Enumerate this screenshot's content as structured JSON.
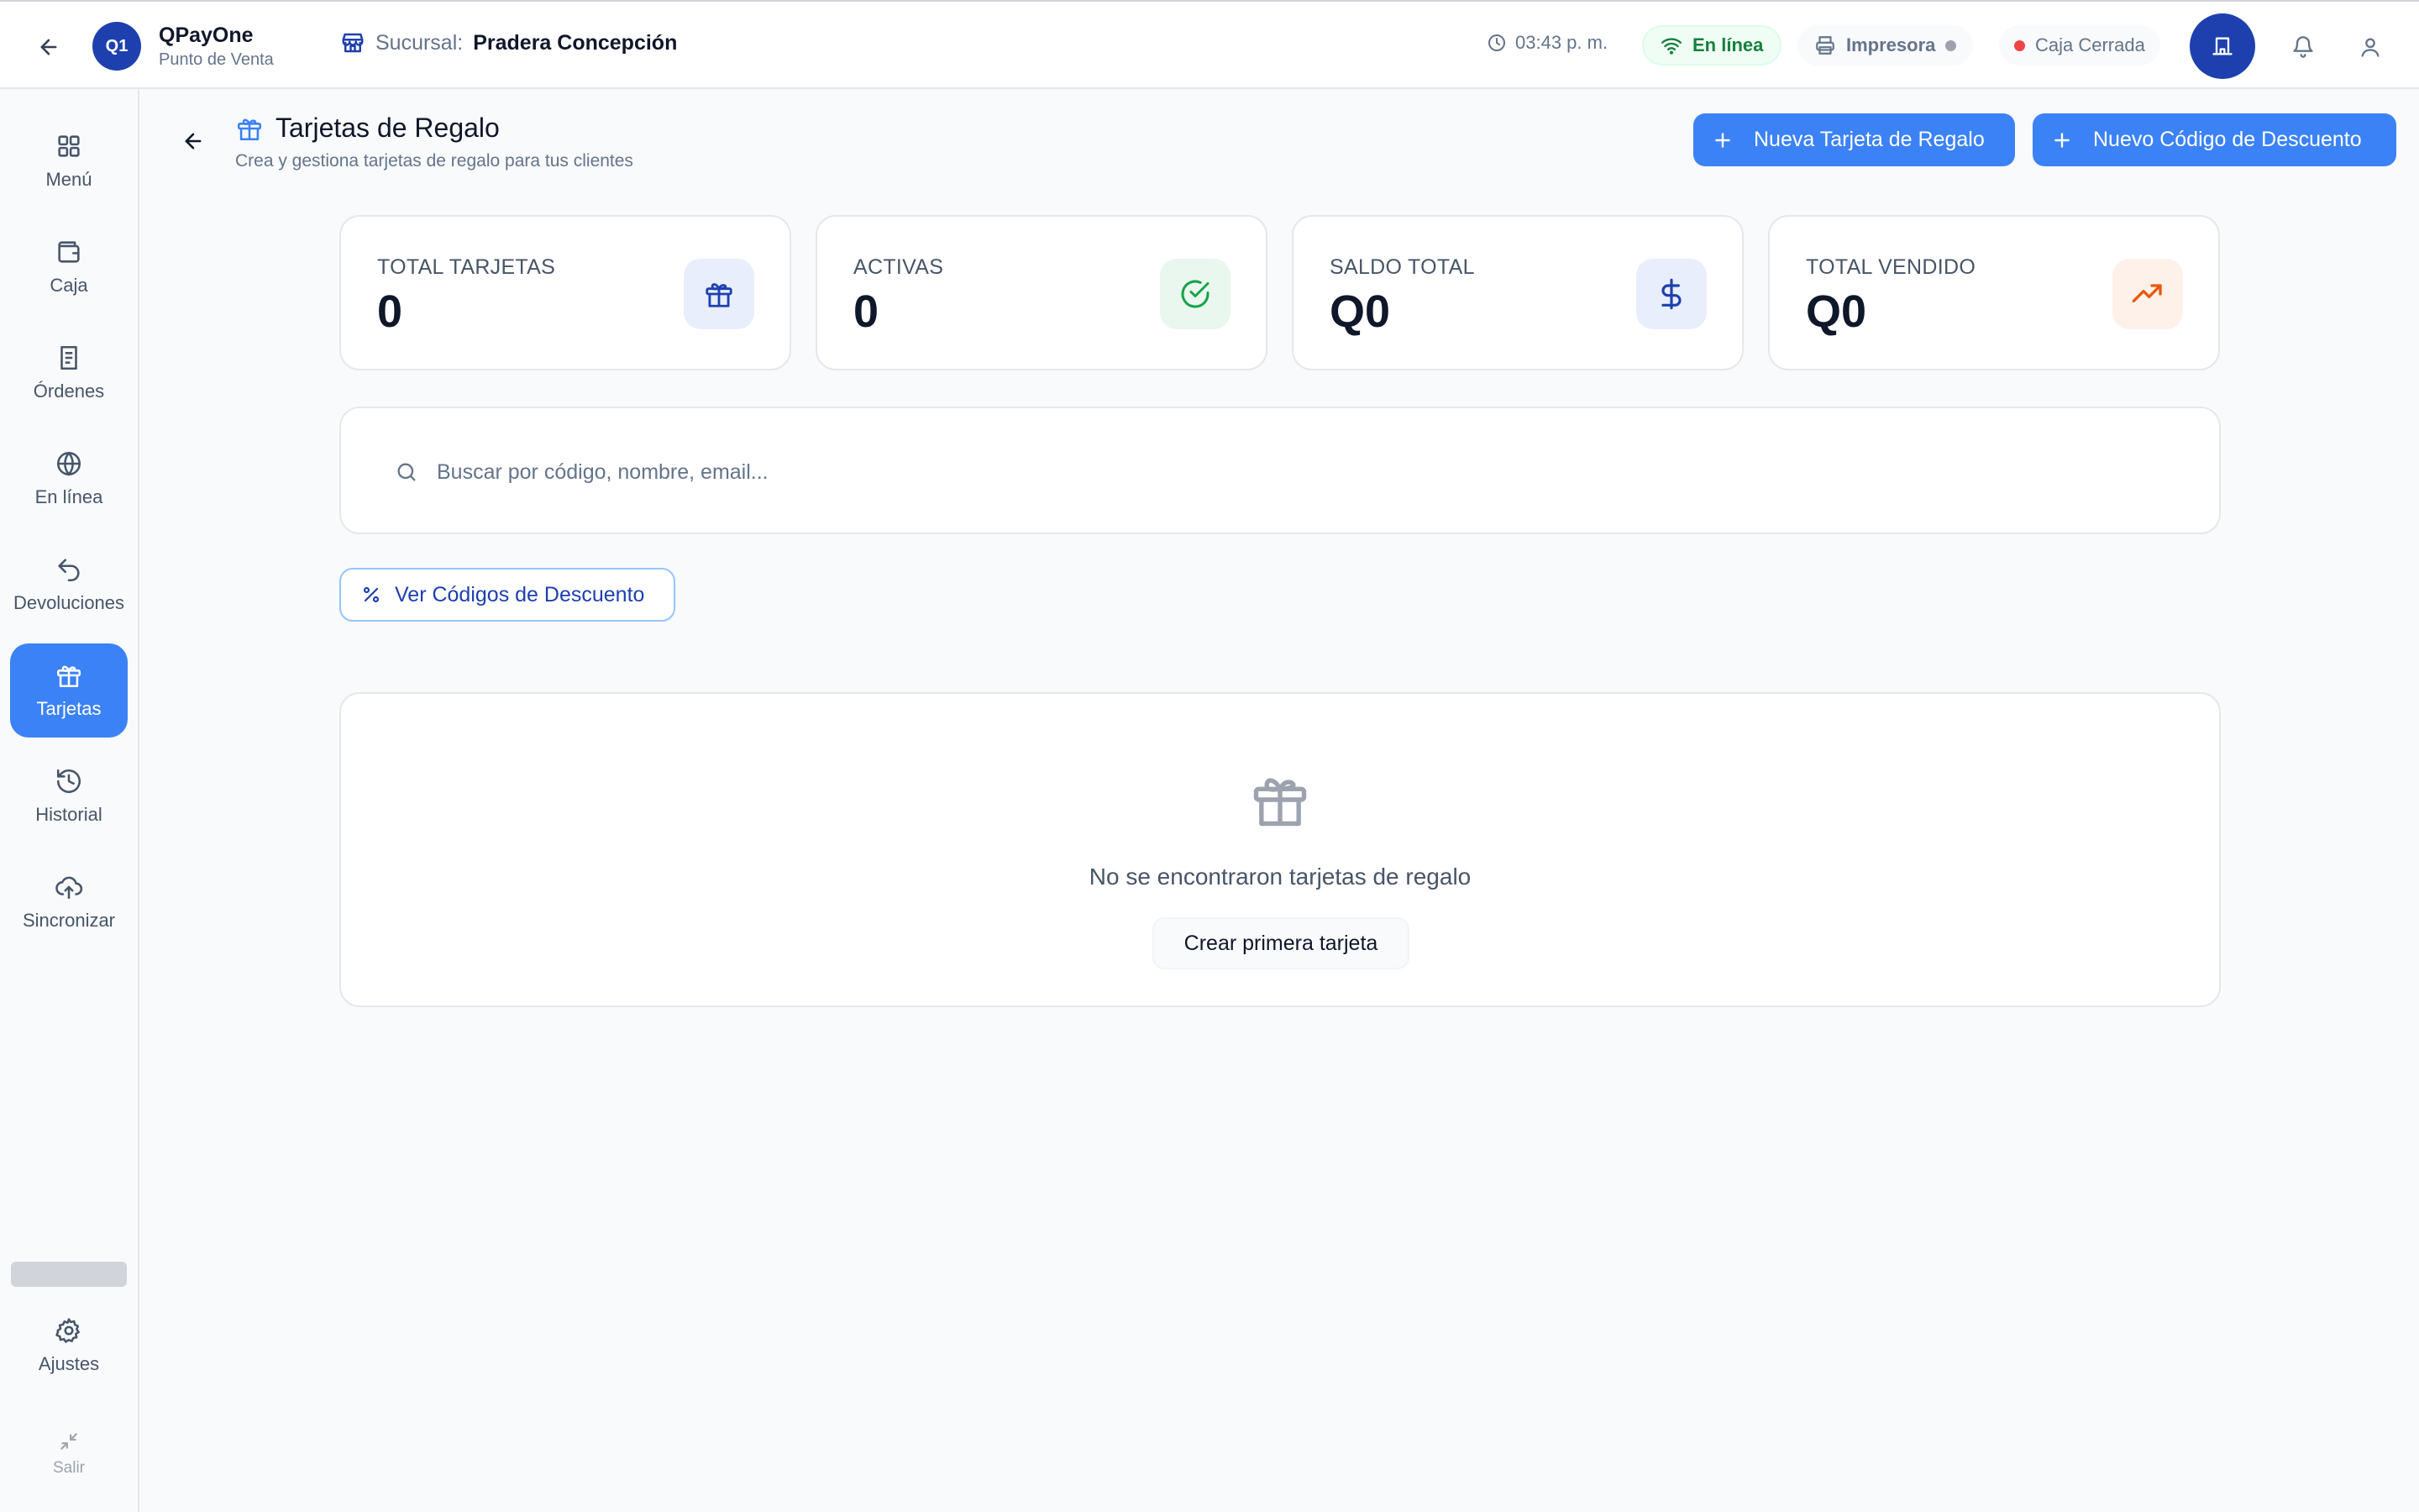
{
  "header": {
    "brand_initials": "Q1",
    "brand_title": "QPayOne",
    "brand_subtitle": "Punto de Venta",
    "branch_label": "Sucursal:",
    "branch_name": "Pradera Concepción",
    "time": "03:43 p. m.",
    "online_status": "En línea",
    "printer_label": "Impresora",
    "register_status": "Caja Cerrada"
  },
  "sidebar": {
    "items": [
      {
        "label": "Menú",
        "icon": "grid-icon"
      },
      {
        "label": "Caja",
        "icon": "wallet-icon"
      },
      {
        "label": "Órdenes",
        "icon": "receipt-icon"
      },
      {
        "label": "En línea",
        "icon": "globe-icon"
      },
      {
        "label": "Devoluciones",
        "icon": "undo-icon"
      },
      {
        "label": "Tarjetas",
        "icon": "gift-icon",
        "active": true
      },
      {
        "label": "Historial",
        "icon": "history-icon"
      },
      {
        "label": "Sincronizar",
        "icon": "cloud-upload-icon"
      }
    ],
    "settings_label": "Ajustes",
    "exit_label": "Salir"
  },
  "page": {
    "title": "Tarjetas de Regalo",
    "subtitle": "Crea y gestiona tarjetas de regalo para tus clientes",
    "new_card_button": "Nueva Tarjeta de Regalo",
    "new_code_button": "Nuevo Código de Descuento"
  },
  "stats": [
    {
      "label": "TOTAL TARJETAS",
      "value": "0",
      "icon": "gift-icon",
      "color": "#1e40af",
      "bg": "#e8eefb"
    },
    {
      "label": "ACTIVAS",
      "value": "0",
      "icon": "check-circle-icon",
      "color": "#16a34a",
      "bg": "#e9f7ee"
    },
    {
      "label": "SALDO TOTAL",
      "value": "Q0",
      "icon": "dollar-icon",
      "color": "#1e40af",
      "bg": "#e8eefb"
    },
    {
      "label": "TOTAL VENDIDO",
      "value": "Q0",
      "icon": "trending-up-icon",
      "color": "#ea580c",
      "bg": "#fdf1ea"
    }
  ],
  "search": {
    "placeholder": "Buscar por código, nombre, email...",
    "value": ""
  },
  "discount_link": "Ver Códigos de Descuento",
  "empty_state": {
    "message": "No se encontraron tarjetas de regalo",
    "button": "Crear primera tarjeta"
  }
}
